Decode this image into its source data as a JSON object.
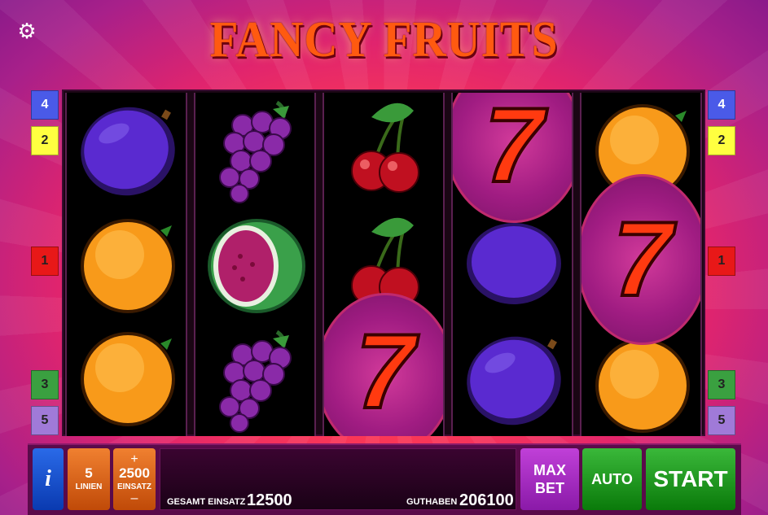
{
  "header": {
    "title": "FANCY FRUITS",
    "settings_icon": "gear-icon"
  },
  "line_markers": {
    "left": [
      "4",
      "2",
      "1",
      "3",
      "5"
    ],
    "right": [
      "4",
      "2",
      "1",
      "3",
      "5"
    ]
  },
  "reels": [
    [
      "plum",
      "orange",
      "orange"
    ],
    [
      "grapes",
      "melon",
      "grapes"
    ],
    [
      "cherries",
      "cherries",
      "seven"
    ],
    [
      "seven",
      "plum",
      "plum"
    ],
    [
      "orange",
      "seven",
      "orange"
    ]
  ],
  "symbols": {
    "seven_label": "7"
  },
  "controls": {
    "info_label": "i",
    "lines_value": "5",
    "lines_label": "LINIEN",
    "bet_plus": "+",
    "bet_value": "2500",
    "bet_label": "EINSATZ",
    "bet_minus": "–",
    "total_bet_label": "GESAMT EINSATZ",
    "total_bet_value": "12500",
    "balance_label": "GUTHABEN",
    "balance_value": "206100",
    "max_bet_line1": "MAX",
    "max_bet_line2": "BET",
    "auto_label": "AUTO",
    "start_label": "START"
  },
  "colors": {
    "marker_4": "#4a5ae8",
    "marker_2": "#ffff40",
    "marker_1": "#e81818",
    "marker_3": "#3aa040",
    "marker_5": "#a07ad8",
    "start_green": "#1a9a1a",
    "max_bet_purple": "#a82ac0",
    "info_blue": "#1a52d0"
  }
}
